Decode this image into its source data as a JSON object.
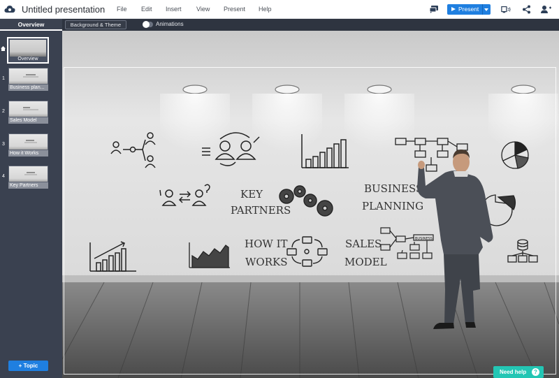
{
  "header": {
    "title": "Untitled presentation",
    "menu": [
      "File",
      "Edit",
      "Insert",
      "View",
      "Present",
      "Help"
    ],
    "present_label": "Present"
  },
  "toolbar": {
    "overview_tab": "Overview",
    "background_theme": "Background & Theme",
    "animations_label": "Animations",
    "animations_on": false
  },
  "sidebar": {
    "overview_label": "Overview",
    "slides": [
      {
        "num": "1",
        "label": "Business plan..."
      },
      {
        "num": "2",
        "label": "Sales Model"
      },
      {
        "num": "3",
        "label": "How it Works"
      },
      {
        "num": "4",
        "label": "Key Partners"
      }
    ],
    "add_topic": "+ Topic"
  },
  "canvas": {
    "texts": {
      "key": "KEY",
      "partners": "PARTNERS",
      "business": "BUSINESS",
      "planning": "PLANNING",
      "how_it": "HOW IT",
      "works": "WORKS",
      "sales": "SALES",
      "model": "MODEL",
      "business_small": "BUSINESS"
    }
  },
  "help": {
    "label": "Need help",
    "icon": "?"
  },
  "colors": {
    "accent": "#1f7fe0",
    "help": "#23c6b4",
    "sidebar": "#3a4150",
    "subbar": "#2e3440"
  },
  "icons": [
    "cloud-logo-icon",
    "comment-icon",
    "play-icon",
    "presenter-icon",
    "share-icon",
    "user-icon",
    "home-icon",
    "help-icon"
  ]
}
